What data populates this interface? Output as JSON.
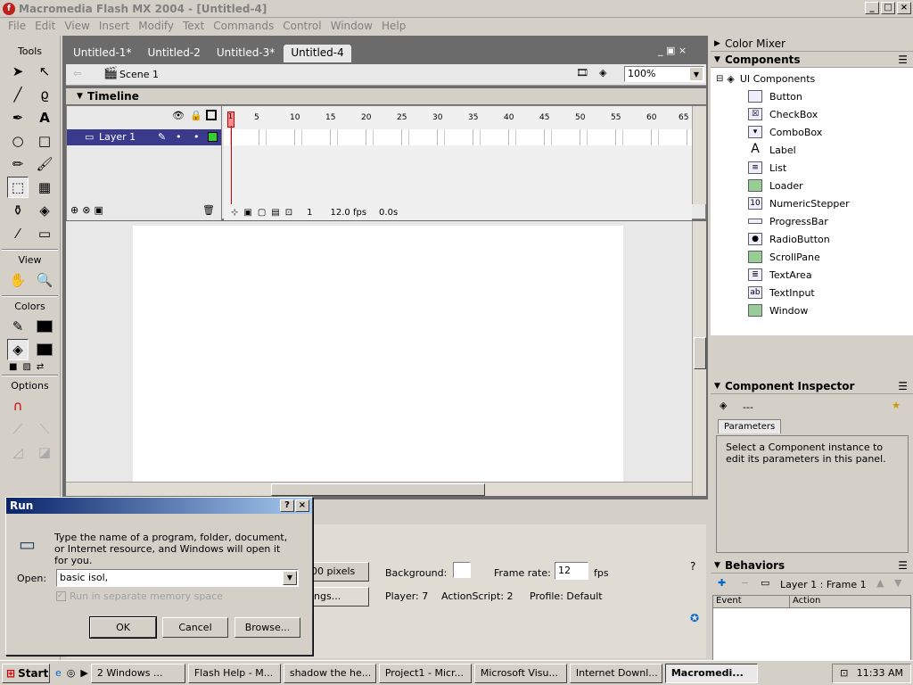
{
  "window": {
    "title": "Macromedia Flash MX 2004 - [Untitled-4]",
    "min": "_",
    "max": "□",
    "close": "×"
  },
  "menu": [
    "File",
    "Edit",
    "View",
    "Insert",
    "Modify",
    "Text",
    "Commands",
    "Control",
    "Window",
    "Help"
  ],
  "tools": {
    "title": "Tools",
    "view_title": "View",
    "colors_title": "Colors",
    "options_title": "Options"
  },
  "tabs": [
    "Untitled-1*",
    "Untitled-2",
    "Untitled-3*",
    "Untitled-4"
  ],
  "scene": {
    "label": "Scene 1",
    "zoom": "100%"
  },
  "timeline": {
    "title": "Timeline",
    "layer": "Layer 1",
    "ruler": [
      "1",
      "5",
      "10",
      "15",
      "20",
      "25",
      "30",
      "35",
      "40",
      "45",
      "50",
      "55",
      "60",
      "65"
    ],
    "frame": "1",
    "fps": "12.0 fps",
    "time": "0.0s"
  },
  "right_panels": {
    "color_mixer": "Color Mixer",
    "components": "Components",
    "ui_components": "UI Components",
    "items": [
      "Button",
      "CheckBox",
      "ComboBox",
      "Label",
      "List",
      "Loader",
      "NumericStepper",
      "ProgressBar",
      "RadioButton",
      "ScrollPane",
      "TextArea",
      "TextInput",
      "Window"
    ],
    "component_inspector": "Component Inspector",
    "inspector_dash": "---",
    "parameters_tab": "Parameters",
    "inspector_msg": "Select a Component instance to edit its parameters in this panel.",
    "behaviors": "Behaviors",
    "behaviors_target": "Layer 1 : Frame 1",
    "event_col": "Event",
    "action_col": "Action"
  },
  "properties": {
    "size": "00 pixels",
    "background_label": "Background:",
    "frame_rate_label": "Frame rate:",
    "frame_rate": "12",
    "fps": "fps",
    "settings": "ings...",
    "player": "Player: 7",
    "actionscript": "ActionScript: 2",
    "profile": "Profile: Default"
  },
  "run": {
    "title": "Run",
    "help": "?",
    "close": "×",
    "desc": "Type the name of a program, folder, document, or Internet resource, and Windows will open it for you.",
    "open_label": "Open:",
    "open_value": "basic isol,",
    "separate": "Run in separate memory space",
    "ok": "OK",
    "cancel": "Cancel",
    "browse": "Browse..."
  },
  "taskbar": {
    "start": "Start",
    "tasks": [
      "2 Windows ...",
      "Flash Help - M...",
      "shadow the he...",
      "Project1 - Micr...",
      "Microsoft Visu...",
      "Internet Downl...",
      "Macromedi..."
    ],
    "time": "11:33 AM"
  },
  "colors": {
    "accent": "#0a246a",
    "stroke": "#000000",
    "fill": "#000000"
  }
}
